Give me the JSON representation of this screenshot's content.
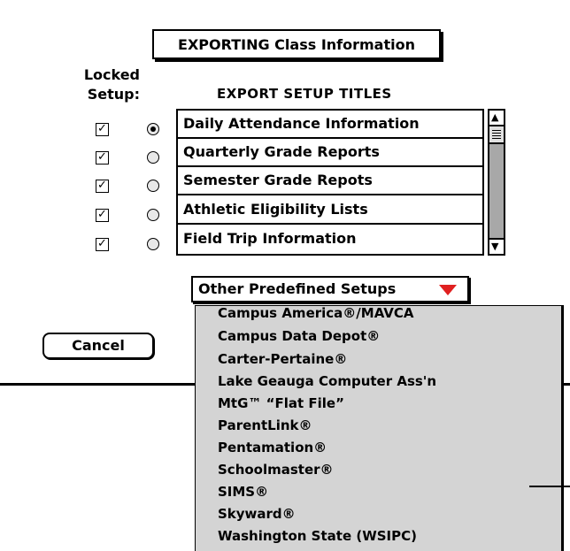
{
  "dialog": {
    "title": "EXPORTING Class Information",
    "locked_label_line1": "Locked",
    "locked_label_line2": "Setup:",
    "titles_header": "EXPORT SETUP TITLES",
    "cancel_label": "Cancel"
  },
  "setups": [
    {
      "title": "Daily Attendance Information",
      "locked": true,
      "selected": true
    },
    {
      "title": "Quarterly Grade Reports",
      "locked": true,
      "selected": false
    },
    {
      "title": "Semester Grade Repots",
      "locked": true,
      "selected": false
    },
    {
      "title": "Athletic Eligibility Lists",
      "locked": true,
      "selected": false
    },
    {
      "title": "Field Trip Information",
      "locked": true,
      "selected": false
    }
  ],
  "popup": {
    "label": "Other Predefined Setups",
    "arrow_color": "#e02020",
    "items": [
      "Campus America®/MAVCA",
      "Campus Data Depot®",
      "Carter-Pertaine®",
      "Lake Geauga Computer Ass'n",
      "MtG™ “Flat File”",
      "ParentLink®",
      "Pentamation®",
      "Schoolmaster®",
      "SIMS®",
      "Skyward®",
      "Washington State (WSIPC)"
    ]
  },
  "icons": {
    "checkbox_mark": "✓",
    "scroll_up": "▲",
    "scroll_down": "▼"
  }
}
